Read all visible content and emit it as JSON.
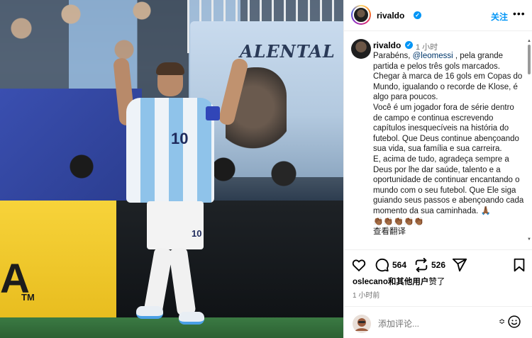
{
  "photo": {
    "banner_text": "ALENTAL",
    "jersey_number": "10",
    "shorts_number": "10",
    "board_letter": "A",
    "board_tm": "TM"
  },
  "header": {
    "username": "rivaldo",
    "follow_label": "关注",
    "more_label": "•••"
  },
  "caption": {
    "username": "rivaldo",
    "time": "1 小时",
    "text_before_mention": "Parabéns, ",
    "mention": "@leomessi",
    "text_after_mention": " , pela grande partida e pelos três gols marcados.\nChegar à marca de 16 gols em Copas do Mundo, igualando o recorde de Klose, é algo para poucos.\nVocê é um jogador fora de série dentro de campo e continua escrevendo capítulos inesquecíveis na história do futebol. Que Deus continue abençoando sua vida, sua família e sua carreira.\nE, acima de tudo, agradeça sempre a Deus por lhe dar saúde, talento e a oportunidade de continuar encantando o mundo com o seu futebol. Que Ele siga guiando seus passos e abençoando cada momento da sua caminhada. ",
    "pray_emoji": "🙏🏾",
    "trailing_emojis": "👏🏾👏🏾👏🏾👏🏾👏🏾",
    "cut_line": "查看翻译"
  },
  "actions": {
    "comment_count": "564",
    "repost_count": "526"
  },
  "likes": {
    "liker": "oslecano",
    "and_others": "和",
    "others_label": "其他用户",
    "suffix": "赞了"
  },
  "posted_time": "1 小时前",
  "comment_box": {
    "placeholder": "添加评论...",
    "emoji_shortcut": "≎"
  },
  "colors": {
    "verified": "#0095f6",
    "follow": "#0095f6",
    "mention": "#00376b",
    "muted": "#737373"
  },
  "icons": {
    "like": "heart-icon",
    "comment": "comment-icon",
    "repost": "repost-icon",
    "share": "send-icon",
    "save": "bookmark-icon",
    "emoji": "smile-icon",
    "more": "more-icon"
  }
}
